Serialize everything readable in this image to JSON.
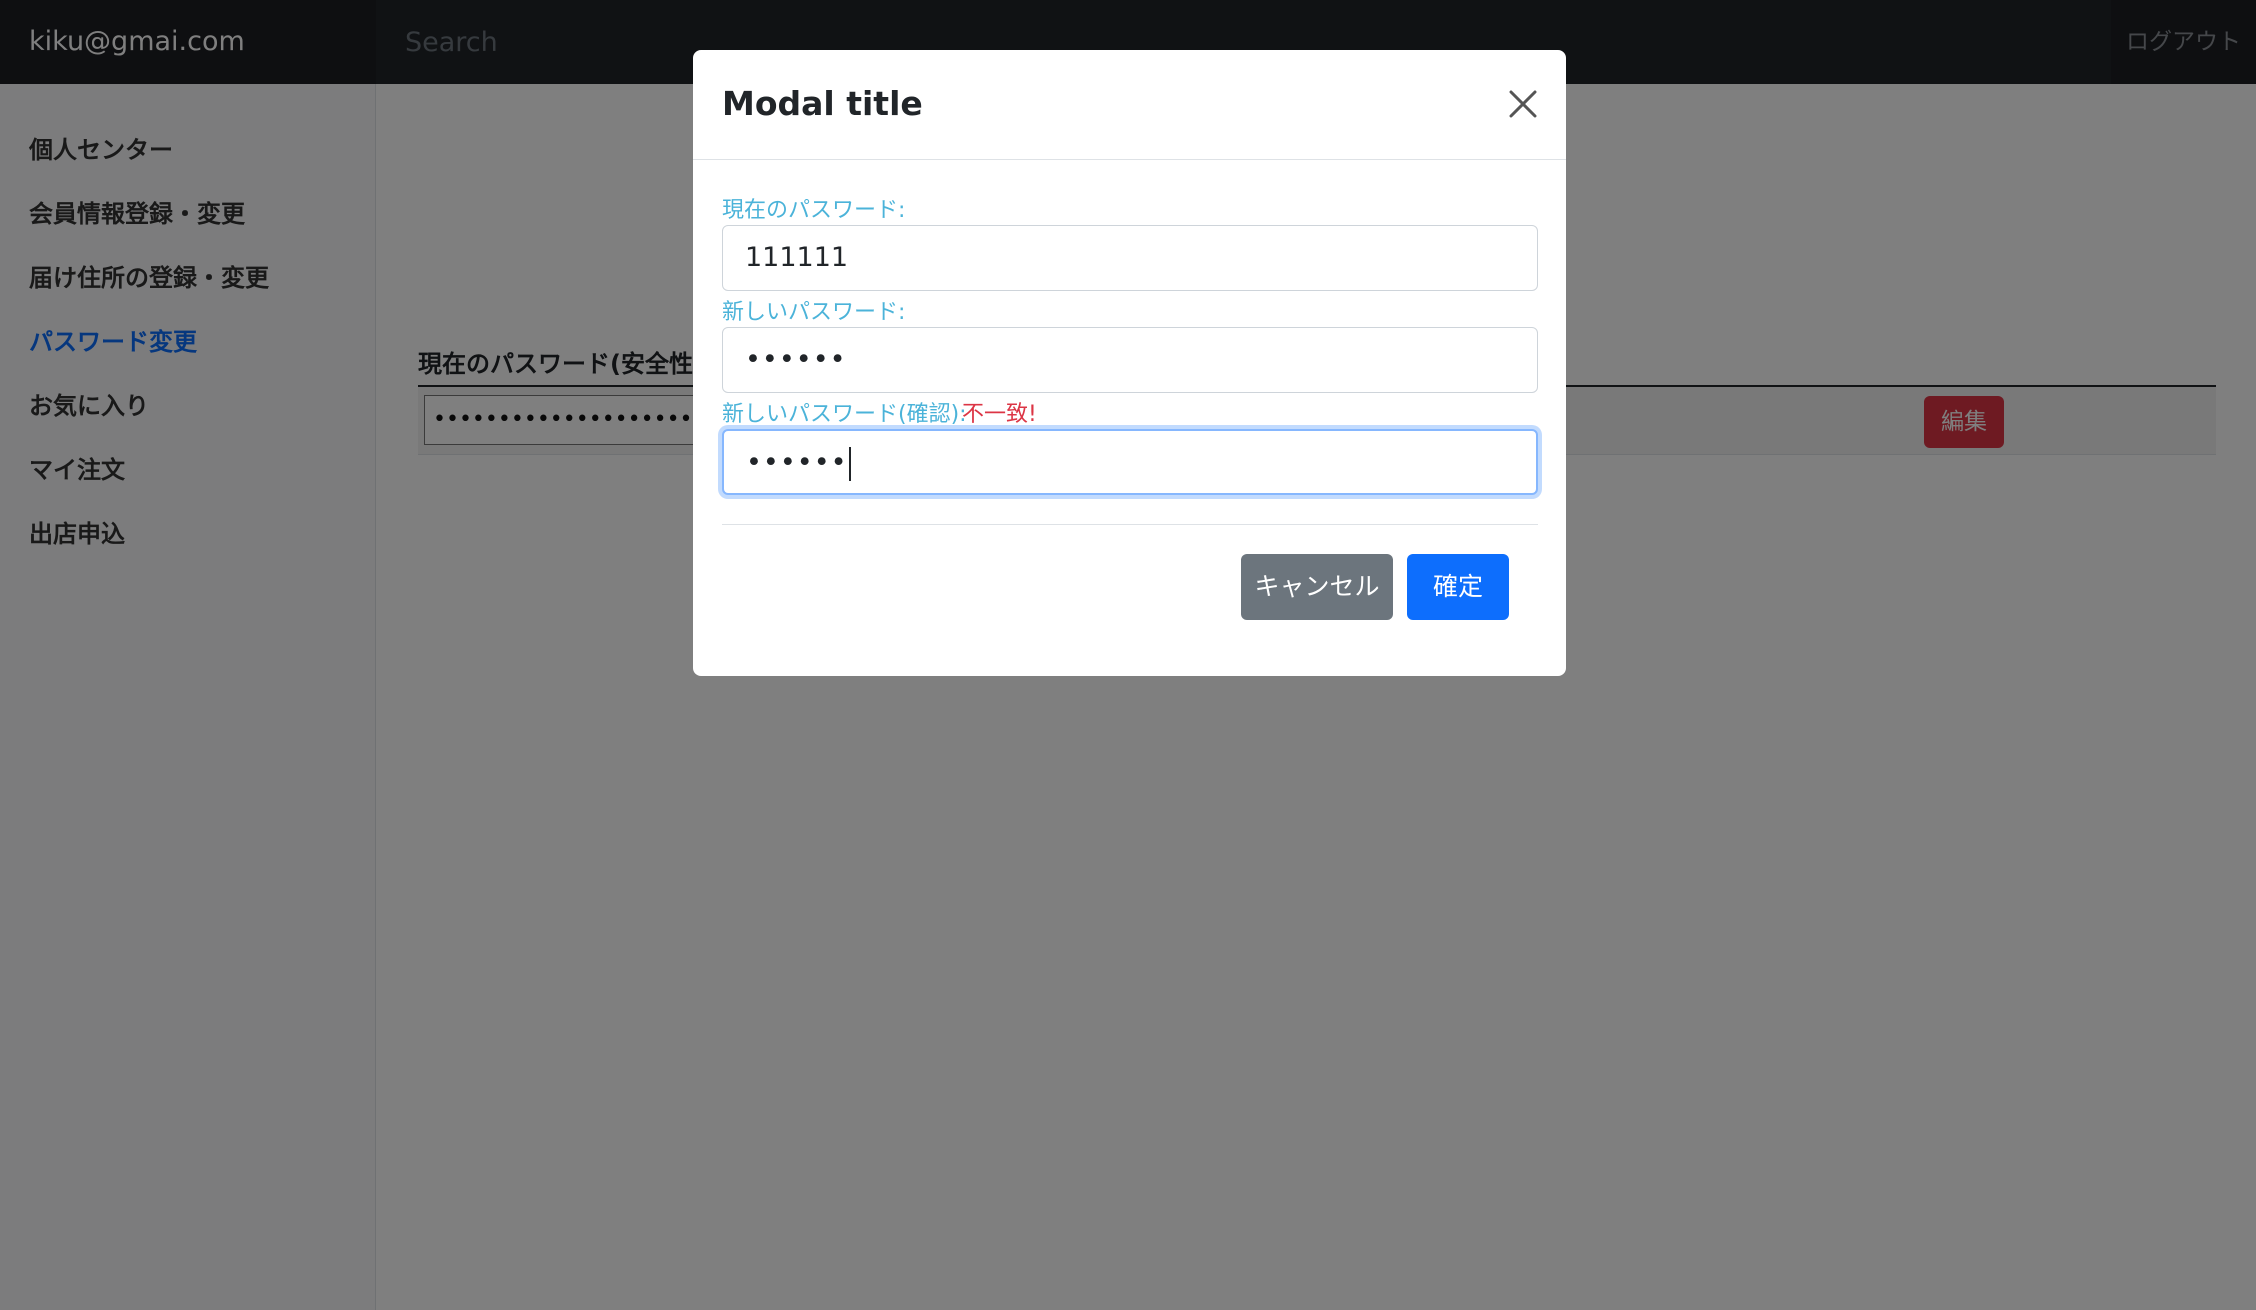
{
  "navbar": {
    "user_email": "kiku@gmai.com",
    "search_placeholder": "Search",
    "logout_label": "ログアウト"
  },
  "sidebar": {
    "items": [
      {
        "label": "個人センター",
        "active": false
      },
      {
        "label": "会員情報登録・変更",
        "active": false
      },
      {
        "label": "届け住所の登録・変更",
        "active": false
      },
      {
        "label": "パスワード変更",
        "active": true
      },
      {
        "label": "お気に入り",
        "active": false
      },
      {
        "label": "マイ注文",
        "active": false
      },
      {
        "label": "出店申込",
        "active": false
      }
    ]
  },
  "main": {
    "table_header": "現在のパスワード(安全性の",
    "password_mask": "••••••••••••••••••••••••••",
    "edit_label": "編集"
  },
  "modal": {
    "title": "Modal title",
    "current_password_label": "現在のパスワード:",
    "current_password_value": "111111",
    "new_password_label": "新しいパスワード:",
    "new_password_value": "••••••",
    "confirm_password_label": "新しいパスワード(確認):",
    "mismatch_message": "不一致!",
    "confirm_password_value": "••••••",
    "cancel_label": "キャンセル",
    "ok_label": "確定"
  },
  "colors": {
    "navbar_bg": "#212529",
    "active_link": "#0d6efd",
    "label": "#4bb3d9",
    "error": "#dc3545",
    "cancel_button": "#6c757d",
    "ok_button": "#0d6efd",
    "edit_button": "#dc3545"
  }
}
